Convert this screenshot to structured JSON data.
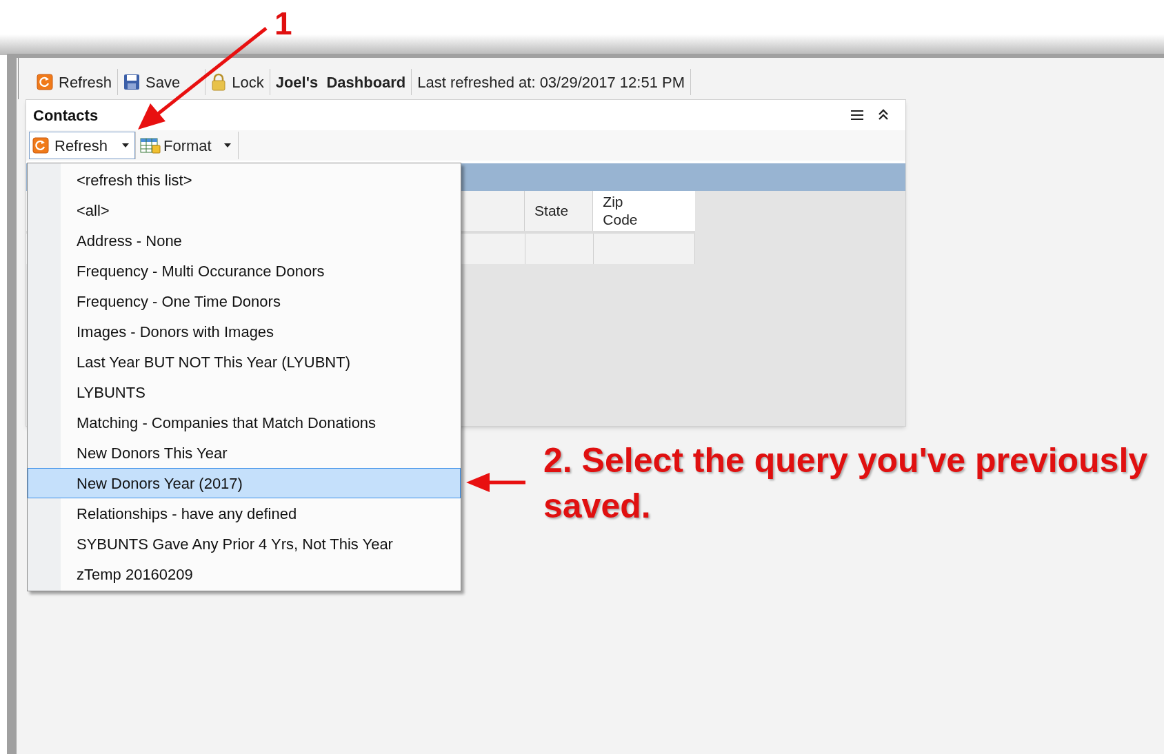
{
  "toolbar": {
    "items": [
      {
        "kind": "refresh",
        "label": "Refresh"
      },
      {
        "kind": "save",
        "label": "Save"
      },
      {
        "kind": "lock",
        "label": "Lock"
      },
      {
        "kind": "title",
        "label": "Joel's  Dashboard"
      },
      {
        "kind": "status",
        "label": "Last refreshed at: 03/29/2017 12:51 PM"
      }
    ]
  },
  "panel": {
    "title": "Contacts",
    "buttons": [
      {
        "kind": "refresh",
        "label": "Refresh"
      },
      {
        "kind": "format",
        "label": "Format"
      }
    ],
    "columns": [
      "State",
      "Zip Code"
    ]
  },
  "dropdown": {
    "items": [
      {
        "label": "<refresh this list>",
        "selected": false
      },
      {
        "label": "<all>",
        "selected": false
      },
      {
        "label": "Address - None",
        "selected": false
      },
      {
        "label": "Frequency - Multi Occurance Donors",
        "selected": false
      },
      {
        "label": "Frequency - One Time Donors",
        "selected": false
      },
      {
        "label": "Images - Donors with Images",
        "selected": false
      },
      {
        "label": "Last Year BUT NOT This Year (LYUBNT)",
        "selected": false
      },
      {
        "label": "LYBUNTS",
        "selected": false
      },
      {
        "label": "Matching - Companies that Match Donations",
        "selected": false
      },
      {
        "label": "New Donors This Year",
        "selected": false
      },
      {
        "label": "New Donors Year (2017)",
        "selected": true
      },
      {
        "label": "Relationships - have any defined",
        "selected": false
      },
      {
        "label": "SYBUNTS Gave Any Prior 4 Yrs, Not This Year",
        "selected": false
      },
      {
        "label": "zTemp 20160209",
        "selected": false
      }
    ]
  },
  "annotations": [
    {
      "kind": "step",
      "text": "1"
    },
    {
      "kind": "callout",
      "text": "2. Select the query you've previously saved."
    }
  ]
}
